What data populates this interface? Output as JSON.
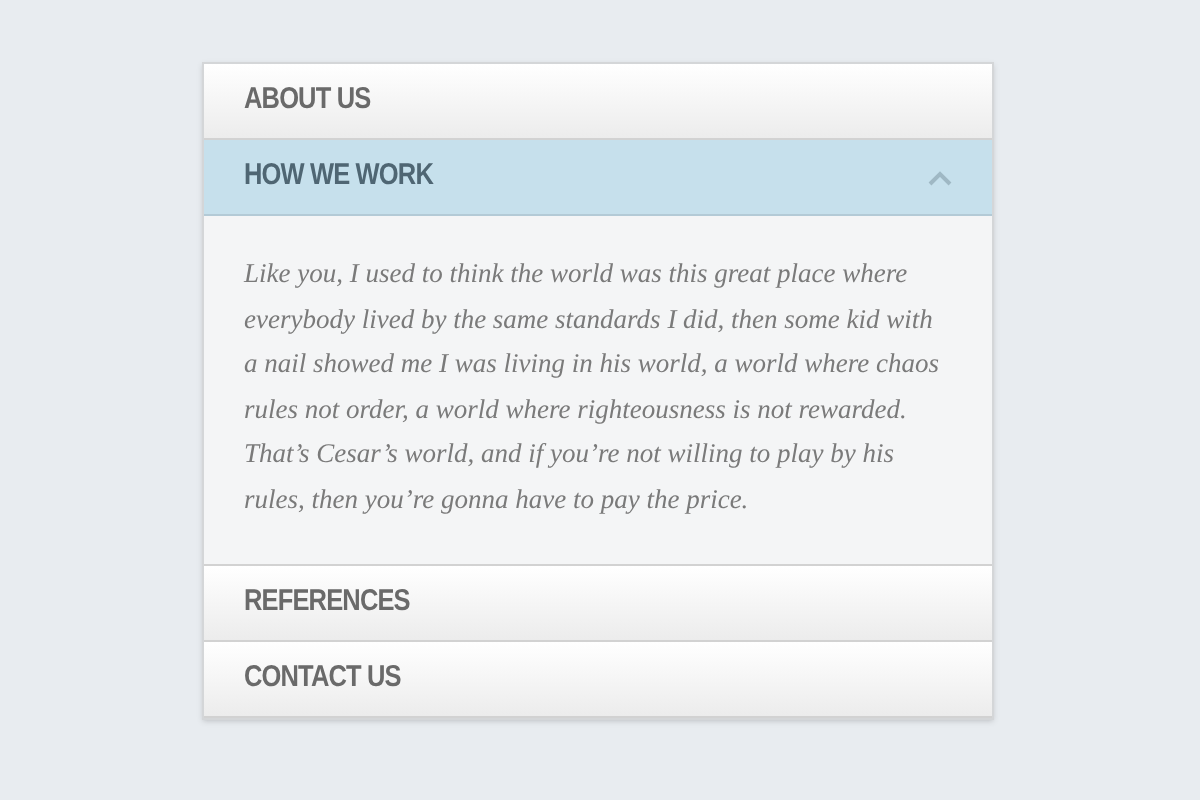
{
  "accordion": [
    {
      "title": "ABOUT US",
      "expanded": false
    },
    {
      "title": "HOW WE WORK",
      "expanded": true,
      "body": "Like you, I used to think the world was this great place where everybody lived by the same standards I did, then some kid with a nail showed me I was living in his world, a world where chaos rules not order, a world where righteousness is not rewarded. That’s Cesar’s world, and if you’re not willing to play by his rules, then you’re gonna have to pay the price."
    },
    {
      "title": "REFERENCES",
      "expanded": false
    },
    {
      "title": "CONTACT US",
      "expanded": false
    }
  ]
}
